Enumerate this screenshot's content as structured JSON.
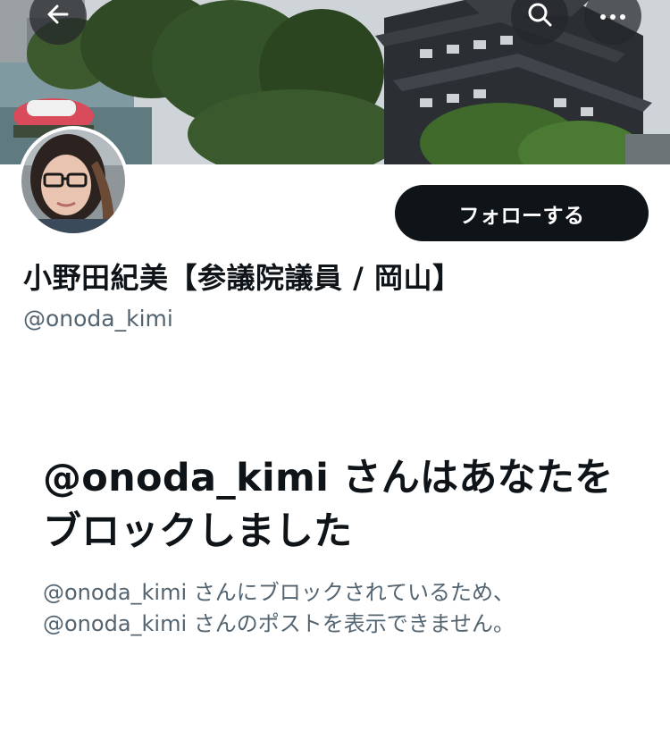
{
  "header": {
    "back_icon": "arrow-left-icon",
    "search_icon": "search-icon",
    "more_icon": "more-horizontal-icon"
  },
  "profile": {
    "display_name": "小野田紀美【参議院議員 / 岡山】",
    "handle": "@onoda_kimi",
    "follow_label": "フォローする"
  },
  "blocked": {
    "title": "@onoda_kimi さんはあなたをブロックしました",
    "description_line1": "@onoda_kimi さんにブロックされているため、",
    "description_line2": "@onoda_kimi さんのポストを表示できません。"
  },
  "colors": {
    "primary_text": "#0f1419",
    "secondary_text": "#536471",
    "button_bg": "#0f1419",
    "overlay_button_bg": "#232629"
  }
}
